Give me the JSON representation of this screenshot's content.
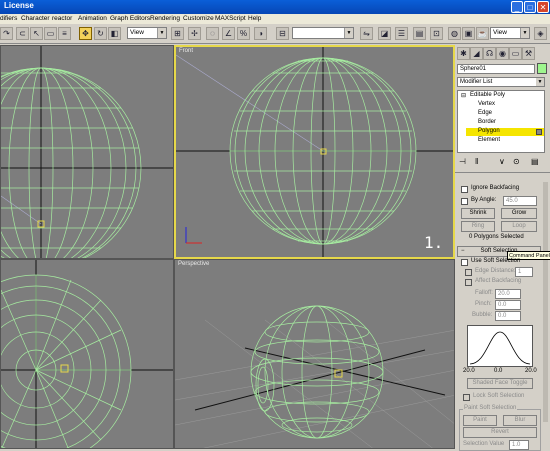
{
  "window": {
    "title": "License",
    "min": "_",
    "max": "□",
    "close": "✕"
  },
  "menu": [
    "difiers",
    "Character",
    "reactor",
    "Animation",
    "Graph Editors",
    "Rendering",
    "Customize",
    "MAXScript",
    "Help"
  ],
  "toolbar": {
    "ref_coord": "View",
    "selection_set": "",
    "right_view": "View"
  },
  "viewports": {
    "top_right_label": "Front",
    "bottom_right_label": "Perspective",
    "overlay_number": "1."
  },
  "command_panel": {
    "object_name": "Sphere01",
    "modifier_list": "Modifier List",
    "stack": [
      "Editable Poly",
      "Vertex",
      "Edge",
      "Border",
      "Polygon",
      "Element"
    ],
    "selected_item": "Polygon",
    "selection": {
      "ignore_backfacing": "Ignore Backfacing",
      "by_angle": "By Angle:",
      "by_angle_value": "45.0",
      "shrink": "Shrink",
      "grow": "Grow",
      "ring": "Ring",
      "loop": "Loop",
      "status": "0 Polygons Selected"
    },
    "soft_selection": {
      "rollout": "Soft Selection",
      "tooltip": "Command Panel",
      "use_soft_selection": "Use Soft Selection",
      "edge_distance": "Edge Distance:",
      "edge_distance_value": "1",
      "affect_backfacing": "Affect Backfacing",
      "falloff_label": "Falloff:",
      "falloff": "20.0",
      "pinch_label": "Pinch:",
      "pinch": "0.0",
      "bubble_label": "Bubble:",
      "bubble": "0.0",
      "curve_left": "20.0",
      "curve_mid": "0.0",
      "curve_right": "20.0",
      "shaded_face_toggle": "Shaded Face Toggle",
      "lock_soft_selection": "Lock Soft Selection",
      "paint_group": "Paint Soft Selection",
      "paint": "Paint",
      "blur": "Blur",
      "revert": "Revert",
      "selection_value": "Selection Value",
      "selection_value_num": "1.0"
    }
  },
  "colors": {
    "wire": "#a6eca0",
    "viewport_bg": "#7d7d7d",
    "active_border": "#e6d84a",
    "highlight": "#f5e500"
  }
}
